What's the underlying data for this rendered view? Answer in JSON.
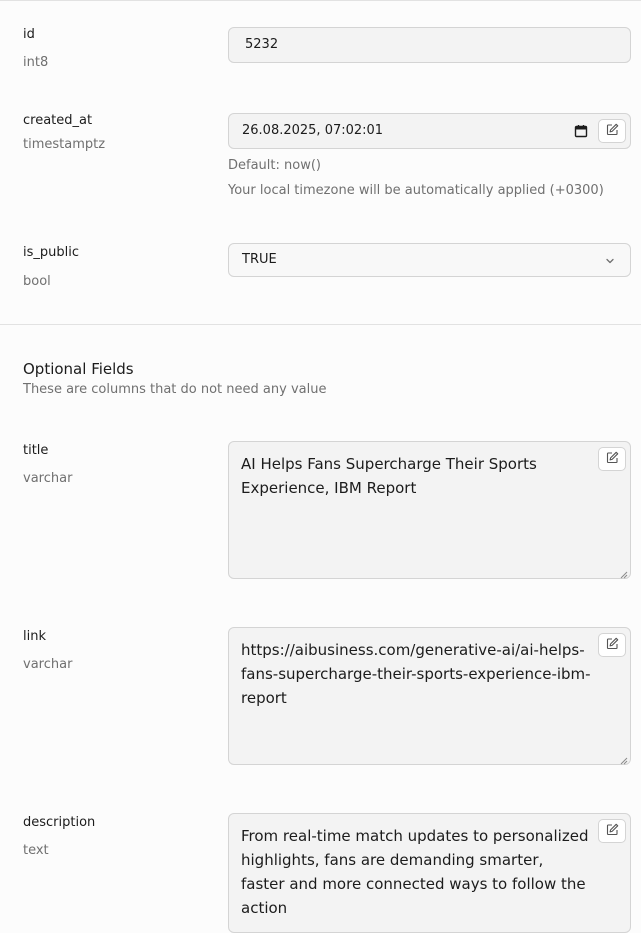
{
  "fields": {
    "id": {
      "name": "id",
      "type": "int8",
      "value": "5232"
    },
    "created_at": {
      "name": "created_at",
      "type": "timestamptz",
      "value": "26.08.2025, 07:02:01",
      "default_hint": "Default: now()",
      "tz_hint": "Your local timezone will be automatically applied (+0300)"
    },
    "is_public": {
      "name": "is_public",
      "type": "bool",
      "value": "TRUE"
    }
  },
  "optional": {
    "title": "Optional Fields",
    "subtitle": "These are columns that do not need any value"
  },
  "optional_fields": {
    "title": {
      "name": "title",
      "type": "varchar",
      "value": "AI Helps Fans Supercharge Their Sports Experience, IBM Report"
    },
    "link": {
      "name": "link",
      "type": "varchar",
      "value": "https://aibusiness.com/generative-ai/ai-helps-fans-supercharge-their-sports-experience-ibm-report"
    },
    "description": {
      "name": "description",
      "type": "text",
      "value": "From real-time match updates to personalized highlights, fans are demanding smarter, faster and more connected ways to follow the action"
    }
  },
  "icons": {
    "edit": "edit-icon",
    "calendar": "calendar-icon",
    "chevron": "chevron-down-icon"
  }
}
